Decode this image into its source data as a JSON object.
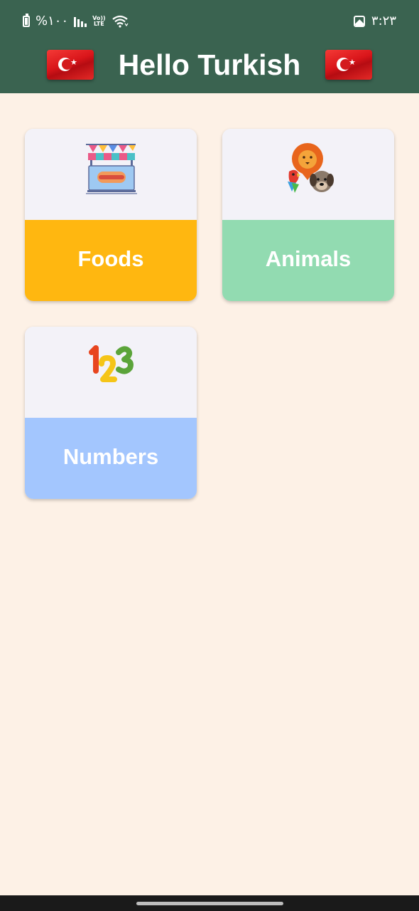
{
  "status_bar": {
    "battery_text": "%۱۰۰",
    "network_label": "Vo)) LTE",
    "time": "۳:۲۳",
    "icons": [
      "battery-icon",
      "signal-icon",
      "volte-icon",
      "wifi-icon",
      "gallery-icon"
    ]
  },
  "header": {
    "title": "Hello Turkish",
    "background": "#3a6350",
    "flag_icon": "turkey-flag-icon"
  },
  "categories": [
    {
      "label": "Foods",
      "color": "#ffb710",
      "icon": "food-stand-icon"
    },
    {
      "label": "Animals",
      "color": "#92dbb1",
      "icon": "animals-icon"
    },
    {
      "label": "Numbers",
      "color": "#a3c6fe",
      "icon": "numbers-123-icon"
    }
  ],
  "colors": {
    "page_background": "#fdf1e6",
    "card_top": "#f3f2f8"
  }
}
